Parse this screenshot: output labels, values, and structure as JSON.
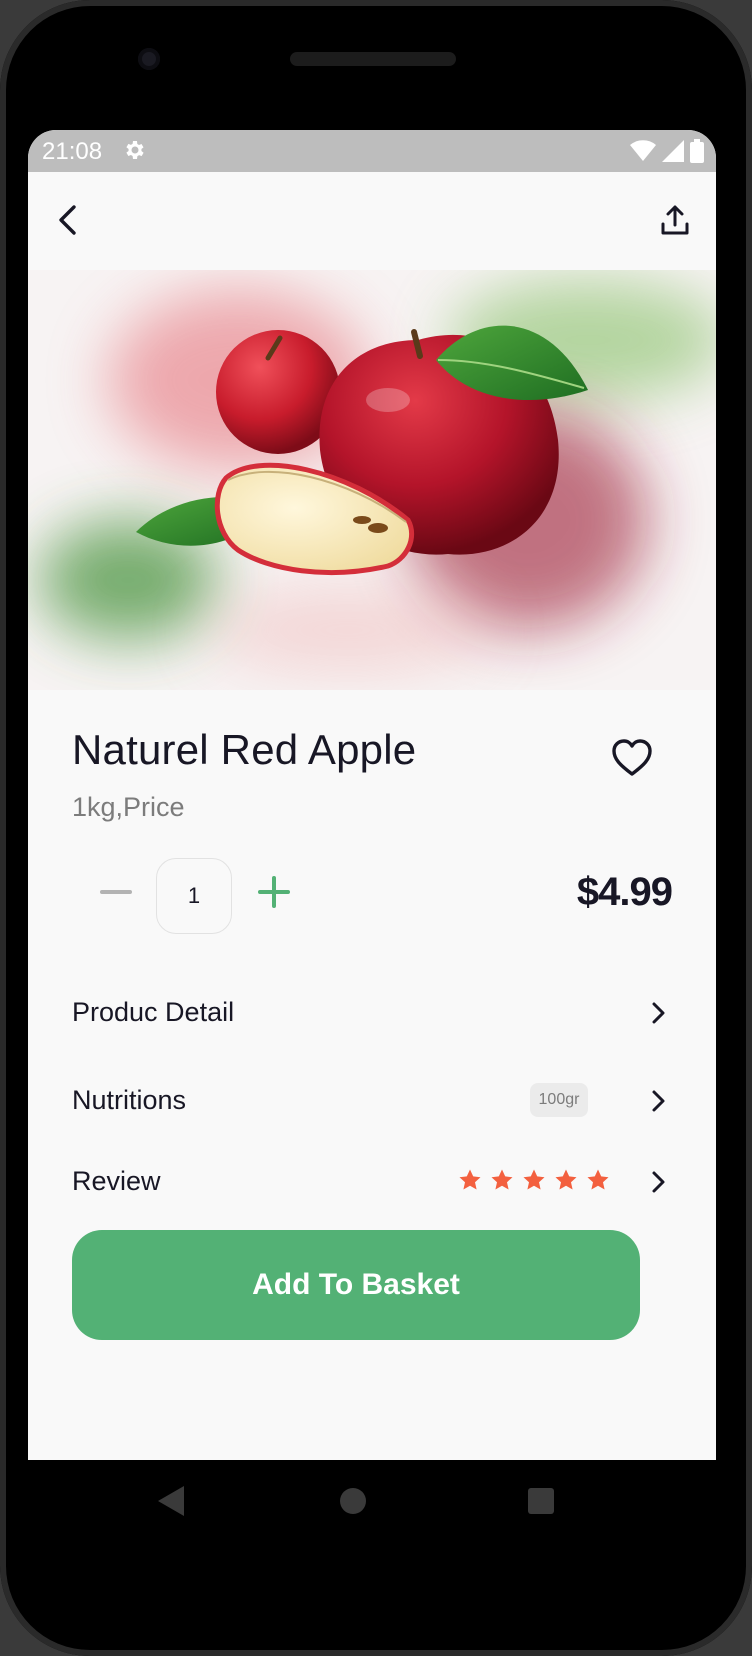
{
  "status_bar": {
    "time": "21:08",
    "icons": [
      "gear-icon",
      "wifi-icon",
      "signal-icon",
      "battery-icon"
    ]
  },
  "top_bar": {
    "back_icon": "chevron-left-icon",
    "share_icon": "share-upload-icon"
  },
  "product": {
    "name": "Naturel Red Apple",
    "unit_price_label": "1kg,Price",
    "price": "$4.99",
    "quantity": "1",
    "favorite_icon": "heart-outline-icon",
    "image_description": "red apples with green leaf"
  },
  "details": [
    {
      "label": "Produc Detail"
    },
    {
      "label": "Nutritions",
      "badge": "100gr"
    },
    {
      "label": "Review",
      "rating": 5,
      "rating_max": 5
    }
  ],
  "actions": {
    "add_to_basket": "Add To Basket"
  },
  "colors": {
    "accent": "#53b175",
    "star": "#f3603f",
    "text_primary": "#181725",
    "text_secondary": "#7c7c7c",
    "background": "#f9f9f9"
  }
}
